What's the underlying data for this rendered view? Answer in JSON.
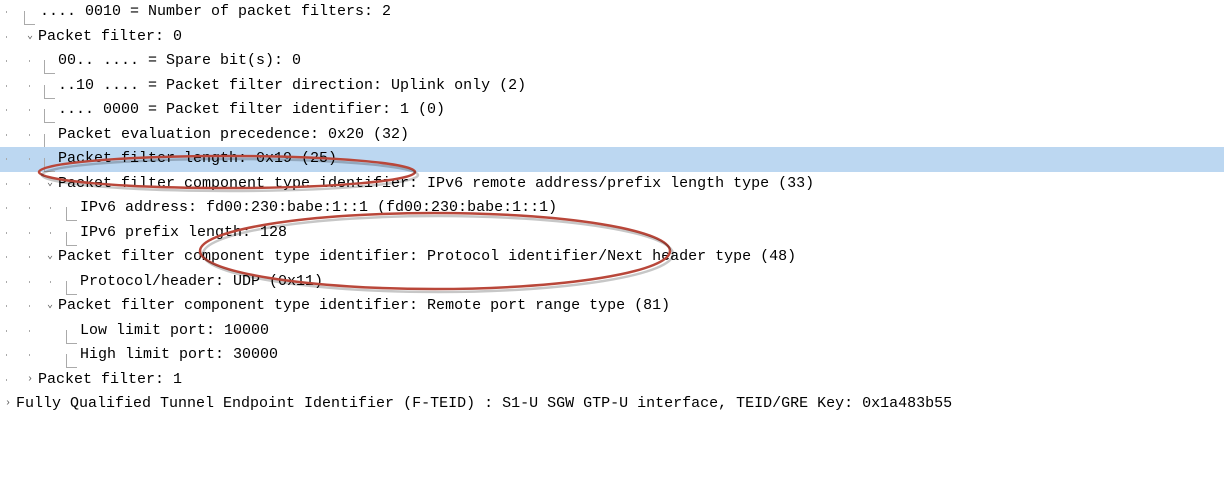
{
  "lines": {
    "l0": ".... 0010 = Number of packet filters: 2",
    "l1": "Packet filter: 0",
    "l2": "00.. .... = Spare bit(s): 0",
    "l3": "..10 .... = Packet filter direction: Uplink only (2)",
    "l4": ".... 0000 = Packet filter identifier: 1 (0)",
    "l5": "Packet evaluation precedence: 0x20 (32)",
    "l6": "Packet filter length: 0x19 (25)",
    "l7": "Packet filter component type identifier: IPv6 remote address/prefix length type (33)",
    "l8": "IPv6 address: fd00:230:babe:1::1 (fd00:230:babe:1::1)",
    "l9": "IPv6 prefix length: 128",
    "l10": "Packet filter component type identifier: Protocol identifier/Next header type (48)",
    "l11": "Protocol/header: UDP (0x11)",
    "l12": "Packet filter component type identifier: Remote port range type (81)",
    "l13": "Low limit port: 10000",
    "l14": "High limit port: 30000",
    "l15": "Packet filter: 1",
    "l16": "Fully Qualified Tunnel Endpoint Identifier (F-TEID) : S1-U SGW GTP-U interface, TEID/GRE Key: 0x1a483b55"
  },
  "toggles": {
    "open": "⌄",
    "closed": "›"
  }
}
